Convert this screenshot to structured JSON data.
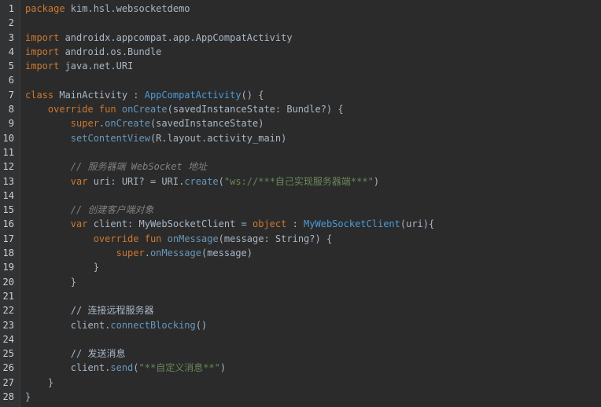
{
  "editor": {
    "lines": [
      [
        [
          "kw",
          "package"
        ],
        [
          "plain",
          " kim.hsl.websocketdemo"
        ]
      ],
      [],
      [
        [
          "kw",
          "import"
        ],
        [
          "plain",
          " androidx.appcompat.app.AppCompatActivity"
        ]
      ],
      [
        [
          "kw",
          "import"
        ],
        [
          "plain",
          " android.os.Bundle"
        ]
      ],
      [
        [
          "kw",
          "import"
        ],
        [
          "plain",
          " java.net.URI"
        ]
      ],
      [],
      [
        [
          "kw",
          "class"
        ],
        [
          "plain",
          " MainActivity : "
        ],
        [
          "cls",
          "AppCompatActivity"
        ],
        [
          "plain",
          "() {"
        ]
      ],
      [
        [
          "plain",
          "    "
        ],
        [
          "kw",
          "override fun"
        ],
        [
          "plain",
          " "
        ],
        [
          "fn",
          "onCreate"
        ],
        [
          "plain",
          "(savedInstanceState: Bundle?) {"
        ]
      ],
      [
        [
          "plain",
          "        "
        ],
        [
          "kw",
          "super"
        ],
        [
          "plain",
          "."
        ],
        [
          "fn",
          "onCreate"
        ],
        [
          "plain",
          "(savedInstanceState)"
        ]
      ],
      [
        [
          "plain",
          "        "
        ],
        [
          "fn",
          "setContentView"
        ],
        [
          "plain",
          "(R.layout.activity_main)"
        ]
      ],
      [],
      [
        [
          "plain",
          "        "
        ],
        [
          "cmt",
          "// 服务器端 WebSocket 地址"
        ]
      ],
      [
        [
          "plain",
          "        "
        ],
        [
          "kw",
          "var"
        ],
        [
          "plain",
          " uri: URI? = URI."
        ],
        [
          "fn",
          "create"
        ],
        [
          "plain",
          "("
        ],
        [
          "str",
          "\"ws://***自己实现服务器端***\""
        ],
        [
          "plain",
          ")"
        ]
      ],
      [],
      [
        [
          "plain",
          "        "
        ],
        [
          "cmt",
          "// 创建客户端对象"
        ]
      ],
      [
        [
          "plain",
          "        "
        ],
        [
          "kw",
          "var"
        ],
        [
          "plain",
          " client: MyWebSocketClient = "
        ],
        [
          "kw",
          "object"
        ],
        [
          "plain",
          " : "
        ],
        [
          "cls",
          "MyWebSocketClient"
        ],
        [
          "plain",
          "(uri){"
        ]
      ],
      [
        [
          "plain",
          "            "
        ],
        [
          "kw",
          "override fun"
        ],
        [
          "plain",
          " "
        ],
        [
          "fn",
          "onMessage"
        ],
        [
          "plain",
          "(message: String?) {"
        ]
      ],
      [
        [
          "plain",
          "                "
        ],
        [
          "kw",
          "super"
        ],
        [
          "plain",
          "."
        ],
        [
          "fn",
          "onMessage"
        ],
        [
          "plain",
          "(message)"
        ]
      ],
      [
        [
          "plain",
          "            }"
        ]
      ],
      [
        [
          "plain",
          "        }"
        ]
      ],
      [],
      [
        [
          "plain",
          "        "
        ],
        [
          "cmt-cn",
          "// 连接远程服务器"
        ]
      ],
      [
        [
          "plain",
          "        client."
        ],
        [
          "fn",
          "connectBlocking"
        ],
        [
          "plain",
          "()"
        ]
      ],
      [],
      [
        [
          "plain",
          "        "
        ],
        [
          "cmt-cn",
          "// 发送消息"
        ]
      ],
      [
        [
          "plain",
          "        client."
        ],
        [
          "fn",
          "send"
        ],
        [
          "plain",
          "("
        ],
        [
          "str",
          "\"**自定义消息**\""
        ],
        [
          "plain",
          ")"
        ]
      ],
      [
        [
          "plain",
          "    }"
        ]
      ],
      [
        [
          "plain",
          "}"
        ]
      ]
    ]
  },
  "colors": {
    "background": "#2b2b2b",
    "gutter": "#313335",
    "keyword": "#cc7832",
    "function": "#6897bb",
    "class_ref": "#4e9ad6",
    "string": "#6a8759",
    "comment": "#808080",
    "text": "#a9b7c6"
  }
}
